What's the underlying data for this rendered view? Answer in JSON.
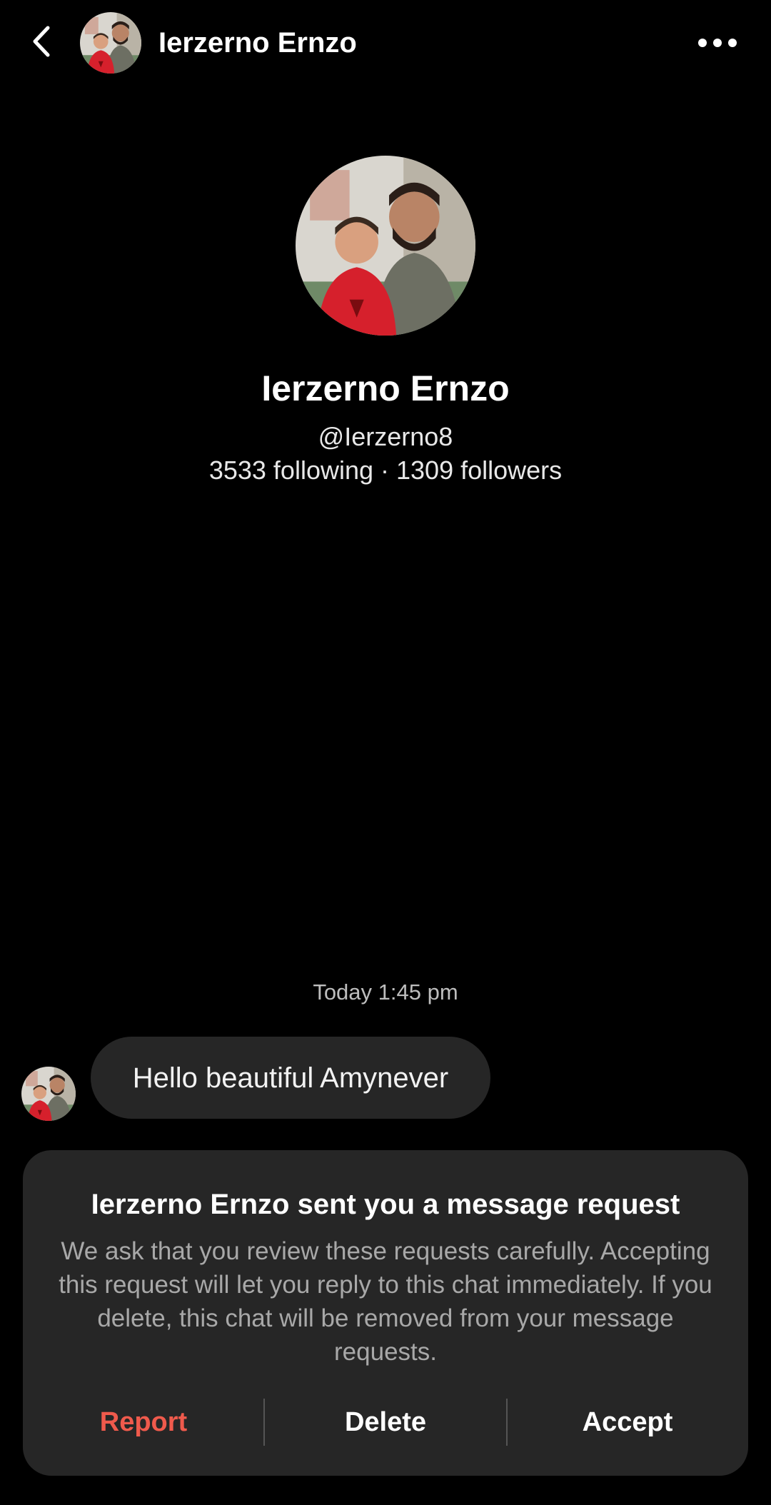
{
  "header": {
    "title": "Ierzerno Ernzo",
    "back_icon": "chevron-left-icon",
    "more_icon": "more-horizontal-icon"
  },
  "profile": {
    "name": "Ierzerno Ernzo",
    "handle": "@Ierzerno8",
    "stats": "3533 following · 1309 followers"
  },
  "conversation": {
    "timestamp": "Today 1:45 pm",
    "messages": [
      {
        "text": "Hello beautiful Amynever"
      }
    ]
  },
  "request": {
    "title": "Ierzerno Ernzo sent you a message request",
    "body": "We ask that you review these requests carefully. Accepting this request will let you reply to this chat immediately. If you delete, this chat will be removed from your message requests.",
    "actions": {
      "report": "Report",
      "delete": "Delete",
      "accept": "Accept"
    }
  },
  "colors": {
    "background": "#000000",
    "card": "#262626",
    "report": "#ef5a4c",
    "muted": "#a8a8a8"
  }
}
